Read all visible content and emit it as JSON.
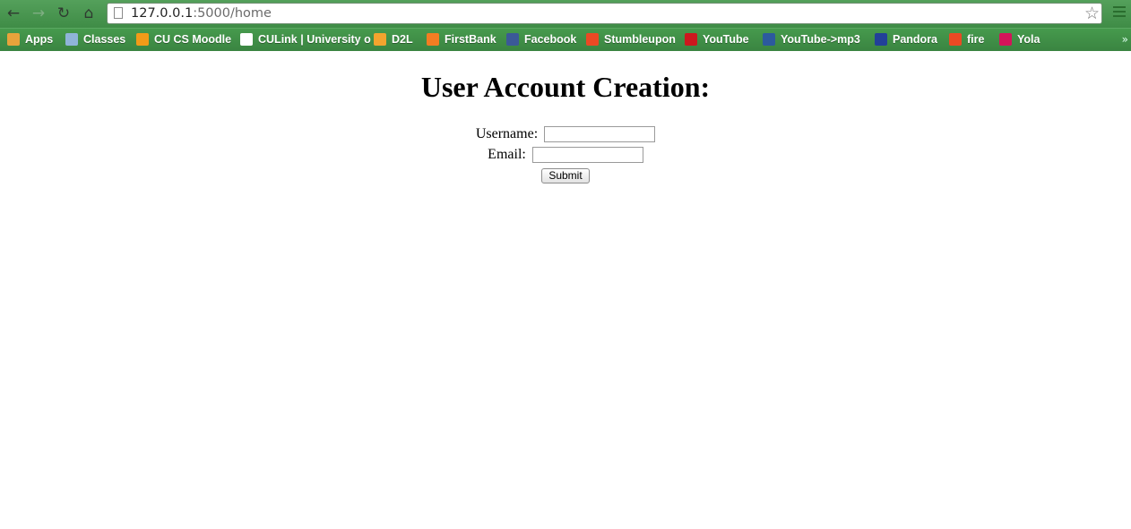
{
  "browser": {
    "url_host": "127.0.0.1",
    "url_rest": ":5000/home",
    "nav": {
      "back_icon": "←",
      "forward_icon": "→",
      "reload_icon": "↻",
      "home_icon": "⌂"
    },
    "star_icon": "☆",
    "bookmarks": [
      {
        "label": "Apps",
        "icon": "apps-grid-icon",
        "color": "#e8a33b"
      },
      {
        "label": "Classes",
        "icon": "folder-icon",
        "color": "#8fb4d9"
      },
      {
        "label": "CU CS Moodle",
        "icon": "moodle-icon",
        "color": "#f29b18"
      },
      {
        "label": "CULink | University o",
        "icon": "page-icon",
        "color": "#ffffff"
      },
      {
        "label": "D2L",
        "icon": "d2l-icon",
        "color": "#f3a42e"
      },
      {
        "label": "FirstBank",
        "icon": "firstbank-icon",
        "color": "#f37d22"
      },
      {
        "label": "Facebook",
        "icon": "facebook-icon",
        "color": "#3b5998"
      },
      {
        "label": "Stumbleupon",
        "icon": "stumbleupon-icon",
        "color": "#eb4924"
      },
      {
        "label": "YouTube",
        "icon": "youtube-icon",
        "color": "#cc181e"
      },
      {
        "label": "YouTube->mp3",
        "icon": "yt-mp3-icon",
        "color": "#2c5a9e"
      },
      {
        "label": "Pandora",
        "icon": "pandora-icon",
        "color": "#224099"
      },
      {
        "label": "fire",
        "icon": "stumbleupon-icon",
        "color": "#eb4924"
      },
      {
        "label": "Yola",
        "icon": "yola-icon",
        "color": "#d4145a"
      }
    ],
    "bookmark_overflow": "»"
  },
  "page": {
    "title": "User Account Creation:",
    "username_label": "Username:",
    "username_value": "",
    "email_label": "Email:",
    "email_value": "",
    "submit_label": "Submit"
  }
}
